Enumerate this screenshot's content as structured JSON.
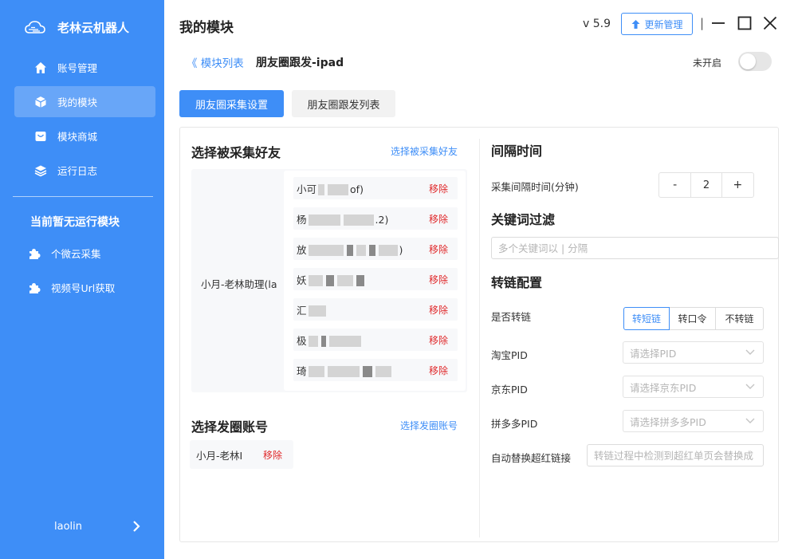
{
  "app": {
    "name": "老林云机器人",
    "version": "v 5.9",
    "update_label": "更新管理"
  },
  "sidebar": {
    "items": [
      {
        "label": "账号管理",
        "icon": "home-icon"
      },
      {
        "label": "我的模块",
        "icon": "cube-icon",
        "active": true
      },
      {
        "label": "模块商城",
        "icon": "shop-icon"
      },
      {
        "label": "运行日志",
        "icon": "layers-icon"
      }
    ],
    "running_title": "当前暂无运行模块",
    "modules": [
      {
        "label": "个微云采集",
        "icon": "puzzle-icon"
      },
      {
        "label": "视频号Url获取",
        "icon": "puzzle-icon"
      }
    ],
    "user": "laolin"
  },
  "header": {
    "title": "我的模块",
    "separator": "|"
  },
  "subheader": {
    "back_label": "《 模块列表",
    "module_title": "朋友圈跟发-ipad",
    "toggle_label": "未开启",
    "toggle_on": false
  },
  "tabs": [
    {
      "label": "朋友圈采集设置",
      "active": true
    },
    {
      "label": "朋友圈跟发列表",
      "active": false
    }
  ],
  "friends_section": {
    "title": "选择被采集好友",
    "link": "选择被采集好友",
    "owner": "小月-老林助理(la",
    "remove_label": "移除",
    "friends": [
      {
        "visible": "小可",
        "tail": "of)"
      },
      {
        "visible": "杨",
        "tail": ".2)"
      },
      {
        "visible": "放",
        "tail": ")"
      },
      {
        "visible": "妖",
        "tail": ""
      },
      {
        "visible": "汇",
        "tail": ""
      },
      {
        "visible": "极",
        "tail": ""
      },
      {
        "visible": "琦",
        "tail": ""
      }
    ]
  },
  "account_section": {
    "title": "选择发圈账号",
    "link": "选择发圈账号",
    "account": "小月-老林I",
    "remove_label": "移除"
  },
  "interval": {
    "title": "间隔时间",
    "label": "采集间隔时间(分钟)",
    "minus": "-",
    "value": "2",
    "plus": "+"
  },
  "keyword": {
    "title": "关键词过滤",
    "placeholder": "多个关键词以 | 分隔"
  },
  "link_conv": {
    "title": "转链配置",
    "convert_label": "是否转链",
    "options": [
      "转短链",
      "转口令",
      "不转链"
    ],
    "selected": "转短链",
    "taobao_label": "淘宝PID",
    "taobao_placeholder": "请选择PID",
    "jd_label": "京东PID",
    "jd_placeholder": "请选择京东PID",
    "pdd_label": "拼多多PID",
    "pdd_placeholder": "请选择拼多多PID",
    "auto_label": "自动替换超红链接",
    "auto_placeholder": "转链过程中检测到超红单页会替换成"
  },
  "colors": {
    "primary": "#3e8ef7",
    "danger": "#e0292b"
  }
}
